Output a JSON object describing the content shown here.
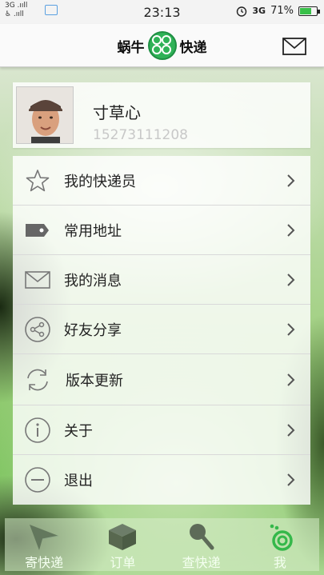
{
  "status_bar": {
    "signal_top": "3G .ııll",
    "signal_bottom": "♿ .ııll",
    "time": "23:13",
    "network": "3G",
    "battery": "71%",
    "battery_level": 0.71
  },
  "header": {
    "logo_left": "蜗牛",
    "logo_right": "快递",
    "mail_icon": "mail-icon"
  },
  "profile": {
    "name": "寸草心",
    "phone": "15273111208"
  },
  "menu": {
    "items": [
      {
        "label": "我的快递员",
        "icon": "star-icon"
      },
      {
        "label": "常用地址",
        "icon": "tag-icon"
      },
      {
        "label": "我的消息",
        "icon": "mail-icon"
      },
      {
        "label": "好友分享",
        "icon": "share-icon"
      },
      {
        "label": "版本更新",
        "icon": "refresh-icon"
      },
      {
        "label": "关于",
        "icon": "info-icon"
      },
      {
        "label": "退出",
        "icon": "minus-circle-icon"
      }
    ]
  },
  "tabs": [
    {
      "label": "寄快递",
      "icon": "paper-plane-icon"
    },
    {
      "label": "订单",
      "icon": "box-icon"
    },
    {
      "label": "查快递",
      "icon": "search-icon"
    },
    {
      "label": "我",
      "icon": "snail-icon",
      "active": true
    }
  ],
  "colors": {
    "accent_green": "#2fb257",
    "active_tab": "#35b84a"
  }
}
